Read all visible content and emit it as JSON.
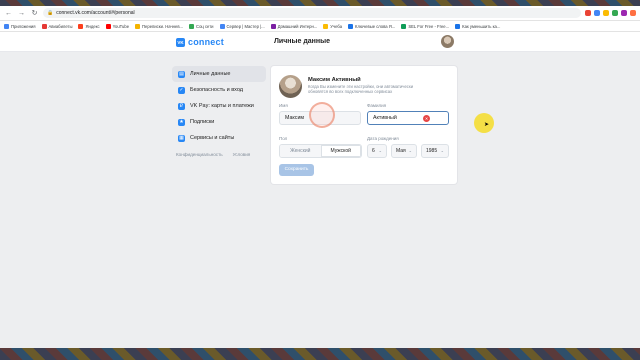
{
  "browser": {
    "url": "connect.vk.com/account/#/personal",
    "bookmarks": [
      "Приложения",
      "Авиабилеты",
      "Яндекс",
      "YouTube",
      "Переписки. Начнев...",
      "Соц сети",
      "Сервер | Мастер |...",
      "Домашний Интерн...",
      "Учеба",
      "Ключевые слова Я...",
      "SEL For Free - Free...",
      "Как уменьшить ка..."
    ],
    "bookmark_colors": [
      "#4285f4",
      "#e53935",
      "#fc3f1d",
      "#ff0000",
      "#f4b400",
      "#34a853",
      "#4285f4",
      "#7b1fa2",
      "#fbbc04",
      "#1a73e8",
      "#0f9d58",
      "#1a73e8"
    ],
    "ext_colors": [
      "#ea4335",
      "#4285f4",
      "#fbbc04",
      "#34a853",
      "#9c27b0",
      "#ff7043"
    ]
  },
  "header": {
    "logo_badge": "VK",
    "logo_text": "connect",
    "title": "Личные данные"
  },
  "sidebar": {
    "items": [
      {
        "label": "Личные данные",
        "icon": "id-card-icon",
        "glyph": "▤"
      },
      {
        "label": "Безопасность и вход",
        "icon": "shield-icon",
        "glyph": "✓"
      },
      {
        "label": "VK Pay: карты и платежи",
        "icon": "payment-icon",
        "glyph": "₽"
      },
      {
        "label": "Подписки",
        "icon": "subscriptions-icon",
        "glyph": "★"
      },
      {
        "label": "Сервисы и сайты",
        "icon": "services-icon",
        "glyph": "▦"
      }
    ],
    "links": [
      "Конфиденциальность",
      "Условия"
    ]
  },
  "profile": {
    "name": "Максим Активный",
    "description": "Когда Вы измените эти настройки, они автоматически обновятся во всех подключенных сервисах",
    "first_name_label": "Имя",
    "first_name_value": "Максим",
    "last_name_label": "Фамилия",
    "last_name_value": "Активный",
    "gender_label": "Пол",
    "gender_options": [
      "Женский",
      "Мужской"
    ],
    "gender_selected": "Мужской",
    "birth_label": "Дата рождения",
    "birth_day": "6",
    "birth_month": "Мая",
    "birth_year": "1985",
    "save_label": "Сохранить"
  }
}
